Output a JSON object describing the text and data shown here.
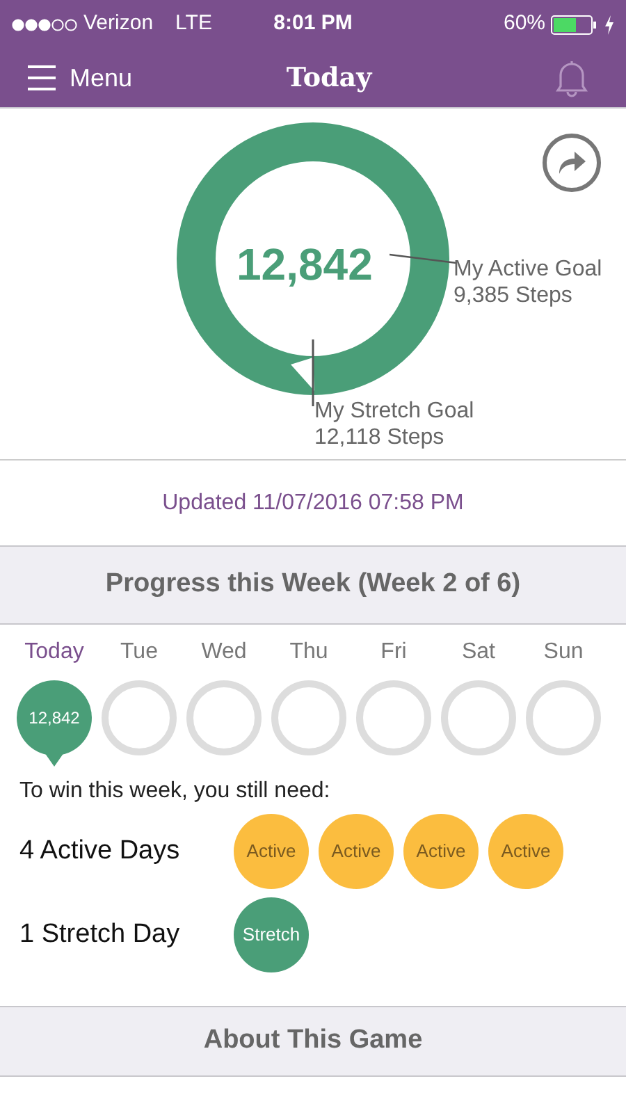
{
  "status_bar": {
    "carrier": "Verizon",
    "network": "LTE",
    "time": "8:01 PM",
    "battery": "60%"
  },
  "nav": {
    "menu_label": "Menu",
    "title": "Today"
  },
  "ring": {
    "steps": "12,842",
    "active_goal_label": "My Active Goal",
    "active_goal_steps": "9,385 Steps",
    "stretch_goal_label": "My Stretch Goal",
    "stretch_goal_steps": "12,118 Steps"
  },
  "updated": "Updated 11/07/2016 07:58 PM",
  "week_header": "Progress this Week (Week 2 of 6)",
  "days": [
    {
      "label": "Today",
      "selected": true,
      "value": "12,842"
    },
    {
      "label": "Tue",
      "selected": false
    },
    {
      "label": "Wed",
      "selected": false
    },
    {
      "label": "Thu",
      "selected": false
    },
    {
      "label": "Fri",
      "selected": false
    },
    {
      "label": "Sat",
      "selected": false
    },
    {
      "label": "Sun",
      "selected": false
    }
  ],
  "need_text": "To win this week, you still need:",
  "needs": [
    {
      "label": "4 Active Days",
      "kind": "active",
      "badges": [
        "Active",
        "Active",
        "Active",
        "Active"
      ]
    },
    {
      "label": "1 Stretch Day",
      "kind": "stretch",
      "badges": [
        "Stretch"
      ]
    }
  ],
  "about_header": "About This Game"
}
